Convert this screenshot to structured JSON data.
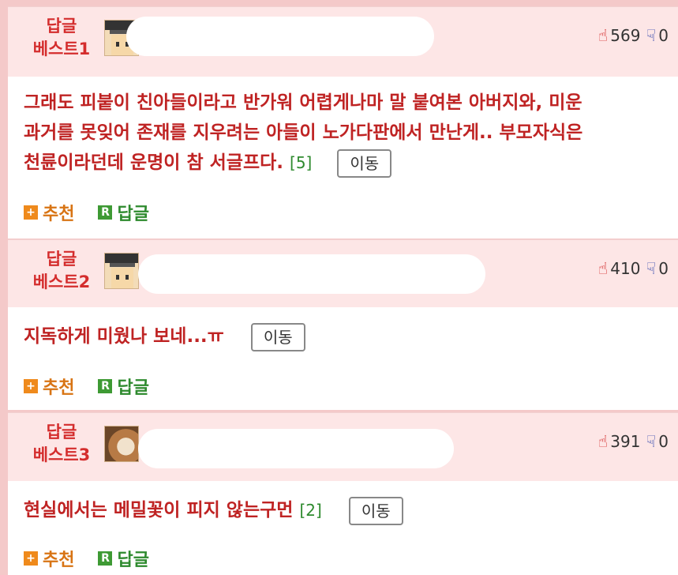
{
  "comments": [
    {
      "badge_line1": "답글",
      "badge_line2": "베스트1",
      "upvotes": "569",
      "downvotes": "0",
      "text_lines": [
        "그래도 피붙이 친아들이라고 반가워 어렵게나마 말 붙여본 아버지와, 미운",
        "과거를 못잊어 존재를 지우려는 아들이 노가다판에서 만난게.. 부모자식은",
        "천륜이라던데 운명이 참 서글프다."
      ],
      "reply_count": "[5]",
      "move_label": "이동",
      "recommend_label": "추천",
      "reply_label": "답글"
    },
    {
      "badge_line1": "답글",
      "badge_line2": "베스트2",
      "upvotes": "410",
      "downvotes": "0",
      "text_lines": [
        "지독하게 미웠나 보네...ㅠ"
      ],
      "reply_count": "",
      "move_label": "이동",
      "recommend_label": "추천",
      "reply_label": "답글"
    },
    {
      "badge_line1": "답글",
      "badge_line2": "베스트3",
      "upvotes": "391",
      "downvotes": "0",
      "text_lines": [
        "현실에서는 메밀꽃이 피지 않는구먼"
      ],
      "reply_count": "[2]",
      "move_label": "이동",
      "recommend_label": "추천",
      "reply_label": "답글"
    }
  ],
  "icons": {
    "thumb_up": "thumb-up-icon",
    "thumb_down": "thumb-down-icon",
    "recommend": "plus-icon",
    "reply": "reply-r-icon"
  },
  "colors": {
    "badge_red": "#d42d2d",
    "comment_red": "#bf2323",
    "header_pink": "#fde6e6",
    "recommend_orange": "#ef8a1c",
    "reply_green": "#3e9a34",
    "thumb_down_blue": "#3d4fb0"
  }
}
